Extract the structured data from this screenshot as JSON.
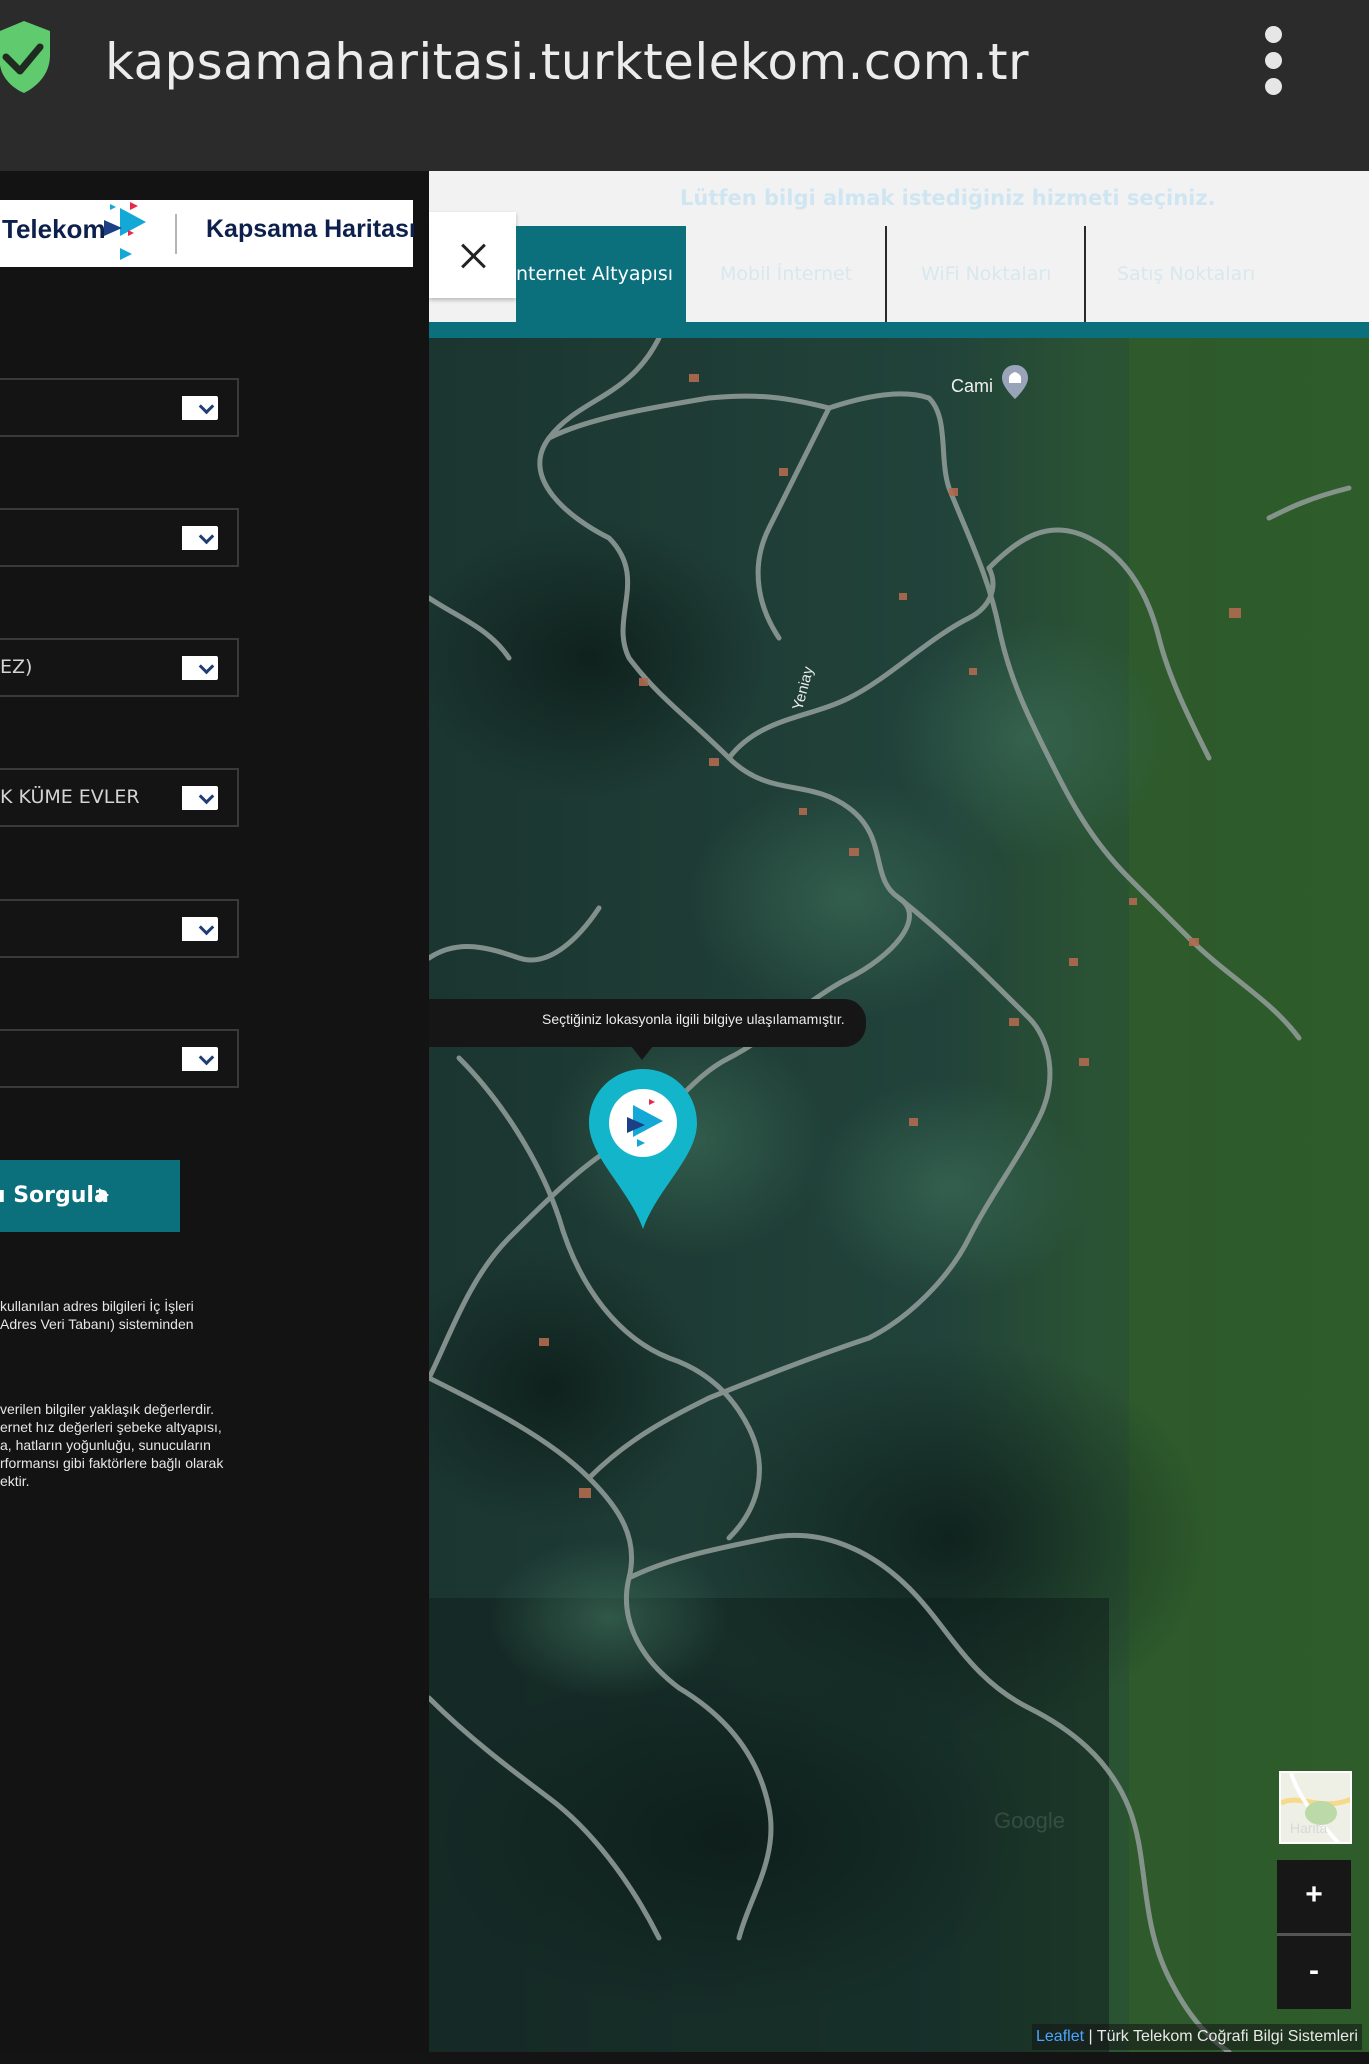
{
  "browser": {
    "url": "kapsamaharitasi.turktelekom.com.tr"
  },
  "brand": {
    "logo_text": "Telekom",
    "title": "Kapsama Haritası"
  },
  "form": {
    "selects": [
      {
        "value": ""
      },
      {
        "value": ""
      },
      {
        "value": "EZ)"
      },
      {
        "value": "K KÜME EVLER"
      },
      {
        "value": ""
      },
      {
        "value": ""
      }
    ],
    "query_button_label": "ı Sorgula"
  },
  "notes": {
    "address_info": [
      " kullanılan adres bilgileri İç İşleri",
      " Adres Veri Tabanı) sisteminden"
    ],
    "speed_info": [
      " verilen bilgiler yaklaşık değerlerdir.",
      "ernet hız değerleri şebeke altyapısı,",
      "a, hatların yoğunluğu, sunucuların",
      "rformansı gibi faktörlere bağlı olarak",
      "ektir."
    ]
  },
  "tabs": {
    "hint": "Lütfen bilgi almak istediğiniz hizmeti seçiniz.",
    "items": [
      {
        "label": "nternet Altyapısı",
        "active": true
      },
      {
        "label": "Mobil İnternet",
        "active": false
      },
      {
        "label": "WiFi Noktaları",
        "active": false
      },
      {
        "label": "Satış Noktaları",
        "active": false
      }
    ]
  },
  "map": {
    "place_labels": {
      "road": "Yeniay",
      "poi": "Cami"
    },
    "popup_text": "Seçtiğiniz lokasyonla ilgili bilgiye ulaşılamamıştır.",
    "layer_label": "Harita",
    "zoom_in": "+",
    "zoom_out": "-",
    "attribution_link": "Leaflet",
    "attribution_text": " | Türk Telekom Coğrafi Bilgi Sistemleri",
    "watermark": "Google"
  },
  "colors": {
    "brand_teal": "#0c6f7c",
    "marker_cyan": "#12b5c9",
    "browser_bar": "#2b2b2b",
    "shield_green": "#5fca6e"
  },
  "icons": [
    "shield-check-icon",
    "more-vert-icon",
    "close-icon",
    "chevron-down-icon",
    "play-triangle-icon",
    "map-marker-icon",
    "mosque-icon"
  ]
}
